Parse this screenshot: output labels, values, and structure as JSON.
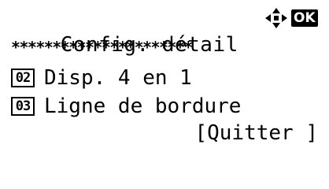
{
  "header": {
    "title": "Config. détail",
    "nav_icon": "four-way-arrow-icon",
    "ok_label": "OK"
  },
  "separator": {
    "text": "**********************"
  },
  "menu": {
    "items": [
      {
        "number": "02",
        "label": "Disp. 4 en 1"
      },
      {
        "number": "03",
        "label": "Ligne de bordure"
      }
    ]
  },
  "softkey": {
    "label": "[Quitter ]"
  }
}
